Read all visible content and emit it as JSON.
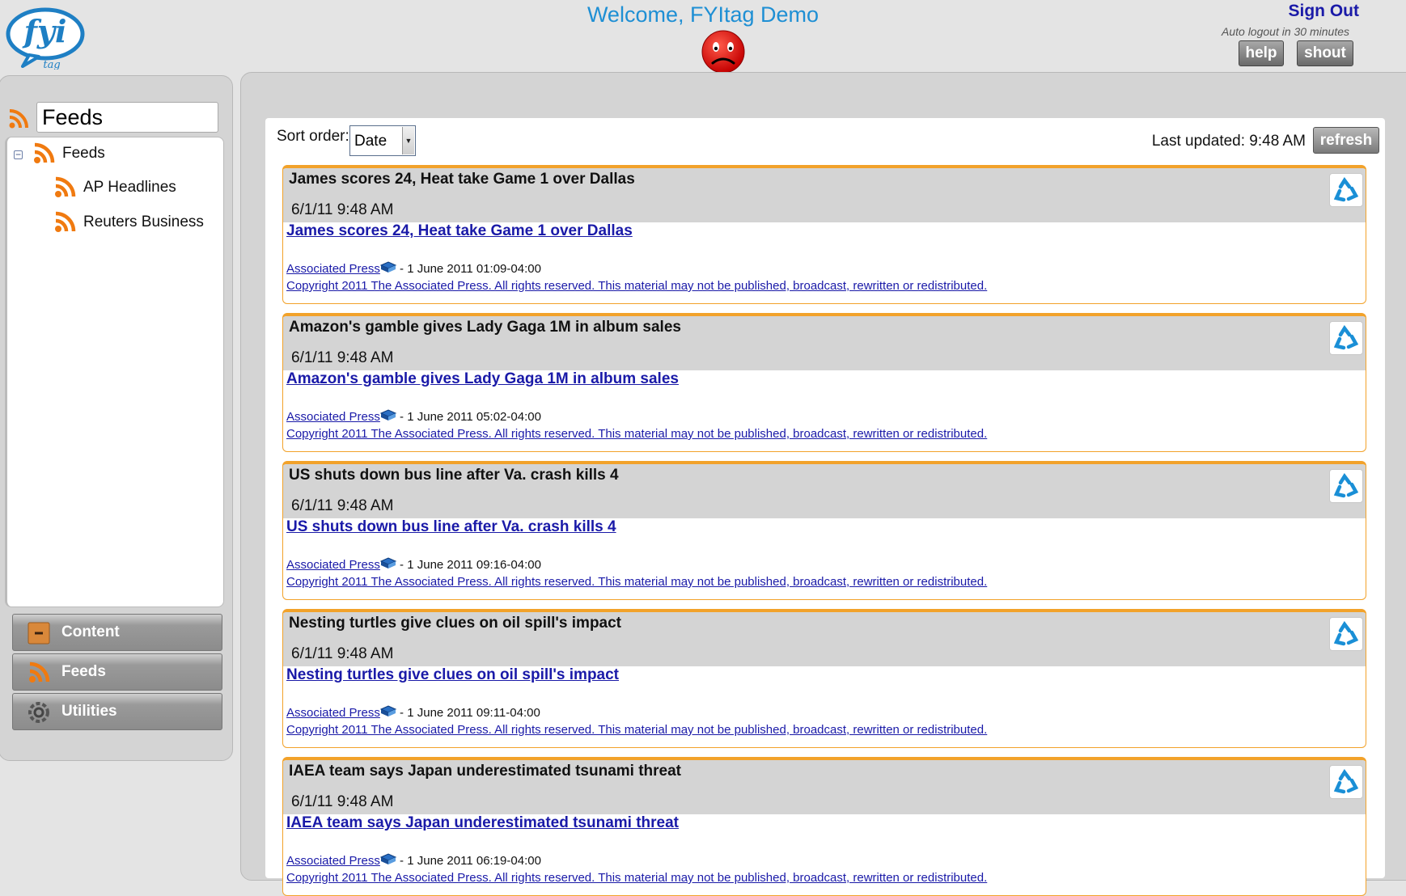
{
  "header": {
    "logo_main": "fyi",
    "logo_sub": "tag",
    "welcome": "Welcome, FYItag Demo",
    "sign_out": "Sign Out",
    "auto_logout": "Auto logout in 30 minutes",
    "help_label": "help",
    "shout_label": "shout"
  },
  "sidebar": {
    "panel_title": "Feeds",
    "tree": {
      "root_label": "Feeds",
      "children": [
        "AP Headlines",
        "Reuters Business"
      ]
    },
    "nav": [
      {
        "label": "Content",
        "icon": "content-icon"
      },
      {
        "label": "Feeds",
        "icon": "rss-icon"
      },
      {
        "label": "Utilities",
        "icon": "utilities-icon"
      }
    ]
  },
  "toolbar": {
    "sort_label": "Sort order:",
    "sort_value": "Date",
    "last_updated": "Last updated: 9:48 AM",
    "refresh_label": "refresh"
  },
  "feed_items": [
    {
      "title": "James scores 24, Heat take Game 1 over Dallas",
      "date": "6/1/11 9:48 AM",
      "link": "James scores 24, Heat take Game 1 over Dallas",
      "source": "Associated Press",
      "published": " - 1 June 2011 01:09-04:00",
      "copyright": "Copyright 2011 The Associated Press. All rights reserved. This material may not be published, broadcast, rewritten or redistributed."
    },
    {
      "title": "Amazon's gamble gives Lady Gaga 1M in album sales",
      "date": "6/1/11 9:48 AM",
      "link": "Amazon's gamble gives Lady Gaga 1M in album sales",
      "source": "Associated Press",
      "published": " - 1 June 2011 05:02-04:00",
      "copyright": "Copyright 2011 The Associated Press. All rights reserved. This material may not be published, broadcast, rewritten or redistributed."
    },
    {
      "title": "US shuts down bus line after Va. crash kills 4",
      "date": "6/1/11 9:48 AM",
      "link": "US shuts down bus line after Va. crash kills 4",
      "source": "Associated Press",
      "published": " - 1 June 2011 09:16-04:00",
      "copyright": "Copyright 2011 The Associated Press. All rights reserved. This material may not be published, broadcast, rewritten or redistributed."
    },
    {
      "title": "Nesting turtles give clues on oil spill's impact",
      "date": "6/1/11 9:48 AM",
      "link": "Nesting turtles give clues on oil spill's impact",
      "source": "Associated Press",
      "published": " - 1 June 2011 09:11-04:00",
      "copyright": "Copyright 2011 The Associated Press. All rights reserved. This material may not be published, broadcast, rewritten or redistributed."
    },
    {
      "title": "IAEA team says Japan underestimated tsunami threat",
      "date": "6/1/11 9:48 AM",
      "link": "IAEA team says Japan underestimated tsunami threat",
      "source": "Associated Press",
      "published": " - 1 June 2011 06:19-04:00",
      "copyright": "Copyright 2011 The Associated Press. All rights reserved. This material may not be published, broadcast, rewritten or redistributed."
    }
  ],
  "colors": {
    "accent_orange": "#f2a22a",
    "link_blue": "#1a1aa8",
    "welcome_blue": "#1e8fd4",
    "panel_gray": "#d4d4d4"
  }
}
